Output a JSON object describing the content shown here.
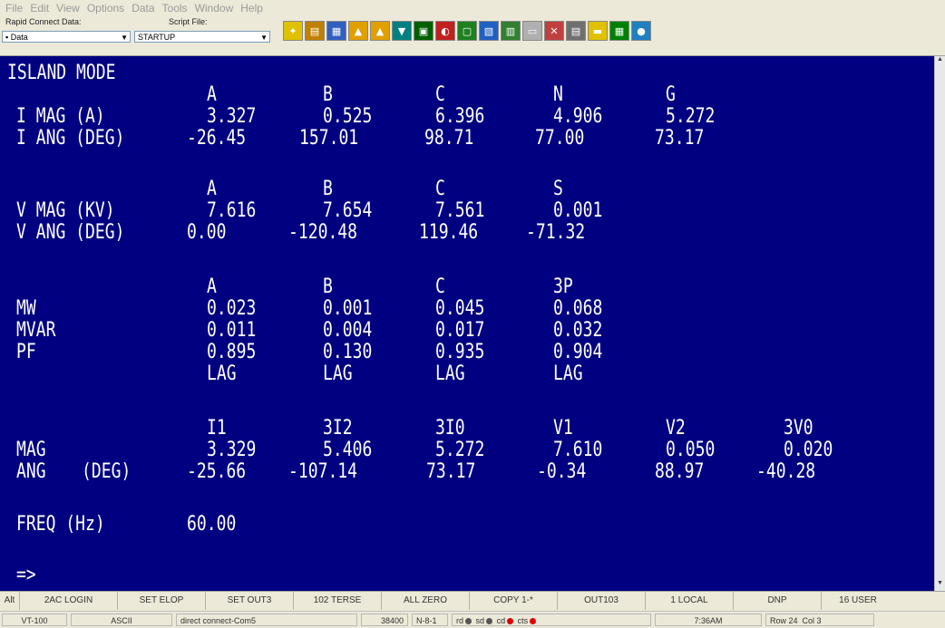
{
  "menu": [
    "File",
    "Edit",
    "View",
    "Options",
    "Data",
    "Tools",
    "Window",
    "Help"
  ],
  "toolbar": {
    "rapid_label": "Rapid Connect Data:",
    "rapid_value": "Data",
    "script_label": "Script File:",
    "script_value": "STARTUP",
    "icons": [
      "run-icon",
      "book-icon",
      "calendar-icon",
      "upload-icon",
      "upload-folder-icon",
      "download-icon",
      "monitor-icon",
      "dial-icon",
      "screen-icon",
      "image-icon",
      "document-icon",
      "network-icon",
      "tools-icon",
      "printer-icon",
      "cable-icon",
      "keypad-icon",
      "help-globe-icon"
    ],
    "icon_colors": [
      "#e0c000",
      "#c08000",
      "#3060c0",
      "#e0a000",
      "#e0a000",
      "#008080",
      "#006000",
      "#c02020",
      "#208020",
      "#2060c0",
      "#308030",
      "#b0b0b0",
      "#c04040",
      "#707070",
      "#e0c000",
      "#008000",
      "#2080c0"
    ]
  },
  "terminal": {
    "title": "ISLAND MODE",
    "current": {
      "headers": [
        "A",
        "B",
        "C",
        "N",
        "G"
      ],
      "mag_label": "I MAG (A)",
      "mag": [
        "3.327",
        "0.525",
        "6.396",
        "4.906",
        "5.272"
      ],
      "ang_label": "I ANG (DEG)",
      "ang": [
        "-26.45",
        "157.01",
        "98.71",
        "77.00",
        "73.17"
      ]
    },
    "voltage": {
      "headers": [
        "A",
        "B",
        "C",
        "S"
      ],
      "mag_label": "V MAG (KV)",
      "mag": [
        "7.616",
        "7.654",
        "7.561",
        "0.001"
      ],
      "ang_label": "V ANG (DEG)",
      "ang": [
        "0.00",
        "-120.48",
        "119.46",
        "-71.32"
      ]
    },
    "power": {
      "headers": [
        "A",
        "B",
        "C",
        "3P"
      ],
      "mw_label": "MW",
      "mw": [
        "0.023",
        "0.001",
        "0.045",
        "0.068"
      ],
      "mvar_label": "MVAR",
      "mvar": [
        "0.011",
        "0.004",
        "0.017",
        "0.032"
      ],
      "pf_label": "PF",
      "pf": [
        "0.895",
        "0.130",
        "0.935",
        "0.904"
      ],
      "lag": [
        "LAG",
        "LAG",
        "LAG",
        "LAG"
      ]
    },
    "sequence": {
      "headers": [
        "I1",
        "3I2",
        "3I0",
        "V1",
        "V2",
        "3V0"
      ],
      "mag_label": "MAG",
      "mag": [
        "3.329",
        "5.406",
        "5.272",
        "7.610",
        "0.050",
        "0.020"
      ],
      "ang_label": "ANG",
      "ang_unit": "(DEG)",
      "ang": [
        "-25.66",
        "-107.14",
        "73.17",
        "-0.34",
        "88.97",
        "-40.28"
      ]
    },
    "freq_label": "FREQ (Hz)",
    "freq": "60.00",
    "prompt": "=>"
  },
  "fkeys": [
    "Alt",
    "2AC LOGIN",
    "SET ELOP",
    "SET OUT3",
    "102 TERSE",
    "ALL ZERO",
    "COPY 1-*",
    "OUT103",
    "1 LOCAL",
    "DNP",
    "16 USER"
  ],
  "status": {
    "term": "VT-100",
    "mode": "ASCII",
    "conn": "direct connect-Com5",
    "baud": "38400",
    "parity": "N-8-1",
    "rd": "rd",
    "sd": "sd",
    "cd": "cd",
    "cts": "cts",
    "time": "7:36AM",
    "row": "Row 24",
    "col": "Col 3"
  }
}
